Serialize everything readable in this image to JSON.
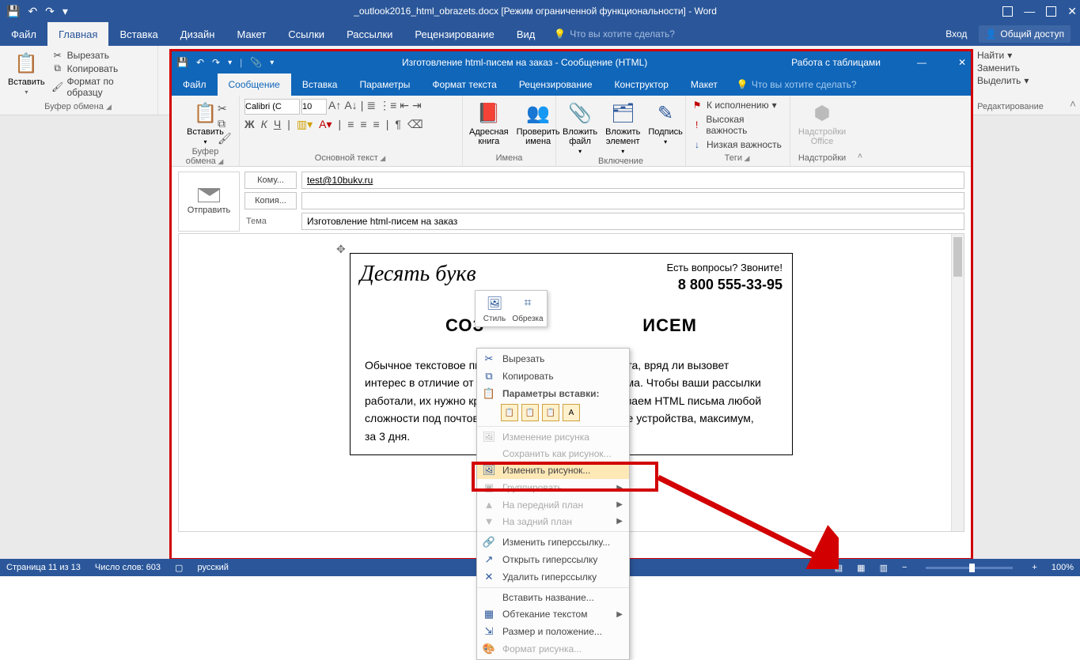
{
  "word": {
    "title": "_outlook2016_html_obrazets.docx [Режим ограниченной функциональности] - Word",
    "tabs": {
      "file": "Файл",
      "home": "Главная",
      "insert": "Вставка",
      "design": "Дизайн",
      "layout": "Макет",
      "refs": "Ссылки",
      "mail": "Рассылки",
      "review": "Рецензирование",
      "view": "Вид"
    },
    "tellme": "Что вы хотите сделать?",
    "signin": "Вход",
    "share": "Общий доступ",
    "clipboard": {
      "paste": "Вставить",
      "cut": "Вырезать",
      "copy": "Копировать",
      "fmtpainter": "Формат по образцу",
      "label": "Буфер обмена"
    },
    "editing": {
      "find": "Найти",
      "replace": "Заменить",
      "select": "Выделить",
      "label": "Редактирование"
    }
  },
  "status": {
    "page": "Страница 11 из 13",
    "words": "Число слов: 603",
    "lang": "русский",
    "zoom": "100%"
  },
  "outlook": {
    "title": "Изготовление html-писем на заказ - Сообщение (HTML)",
    "tabletools": "Работа с таблицами",
    "tabs": {
      "file": "Файл",
      "message": "Сообщение",
      "insert": "Вставка",
      "options": "Параметры",
      "format": "Формат текста",
      "review": "Рецензирование",
      "design": "Конструктор",
      "layout": "Макет"
    },
    "tellme": "Что вы хотите сделать?",
    "ribbon": {
      "clipboard": {
        "paste": "Вставить",
        "label": "Буфер обмена"
      },
      "font": {
        "name": "Calibri (С",
        "size": "10",
        "label": "Основной текст"
      },
      "names": {
        "addr": "Адресная книга",
        "check": "Проверить имена",
        "label": "Имена"
      },
      "include": {
        "attachfile": "Вложить файл",
        "attachitem": "Вложить элемент",
        "signature": "Подпись",
        "label": "Включение"
      },
      "tags": {
        "followup": "К исполнению",
        "high": "Высокая важность",
        "low": "Низкая важность",
        "label": "Теги"
      },
      "addins": {
        "title": "Надстройки Office",
        "label": "Надстройки"
      }
    },
    "compose": {
      "send": "Отправить",
      "to": "Кому...",
      "cc": "Копия...",
      "subjlabel": "Тема",
      "to_val": "test@10bukv.ru",
      "cc_val": "",
      "subject": "Изготовление html-писем на заказ"
    }
  },
  "minitool": {
    "style": "Стиль",
    "crop": "Обрезка"
  },
  "context": {
    "cut": "Вырезать",
    "copy": "Копировать",
    "pastehdr": "Параметры вставки:",
    "changepic": "Изменение рисунка",
    "saveas": "Сохранить как рисунок...",
    "editpic": "Изменить рисунок...",
    "group": "Группировать",
    "front": "На передний план",
    "back": "На задний план",
    "hyper": "Изменить гиперссылку...",
    "openhyper": "Открыть гиперссылку",
    "removehyper": "Удалить гиперссылку",
    "caption": "Вставить название...",
    "wrap": "Обтекание текстом",
    "sizepos": "Размер и положение...",
    "picfmt": "Формат рисунка..."
  },
  "email": {
    "logo": "Десять букв",
    "questions": "Есть вопросы? Звоните!",
    "phone": "8 800 555-33-95",
    "heading_a": "СОЗ",
    "heading_b": "ИСЕМ",
    "body_l1": "Обычное текстовое пись",
    "body_r1": "та, вряд ли вызовет",
    "body_l2": "интерес в отличие от кра",
    "body_r2": "ьма. Чтобы ваши рассылки",
    "body_l3": "работали, их нужно крас",
    "body_r3": "ываем HTML письма любой",
    "body_l4": "сложности под почтовые",
    "body_r4": "ные устройства, максимум,",
    "body_l5": "за 3 дня."
  }
}
